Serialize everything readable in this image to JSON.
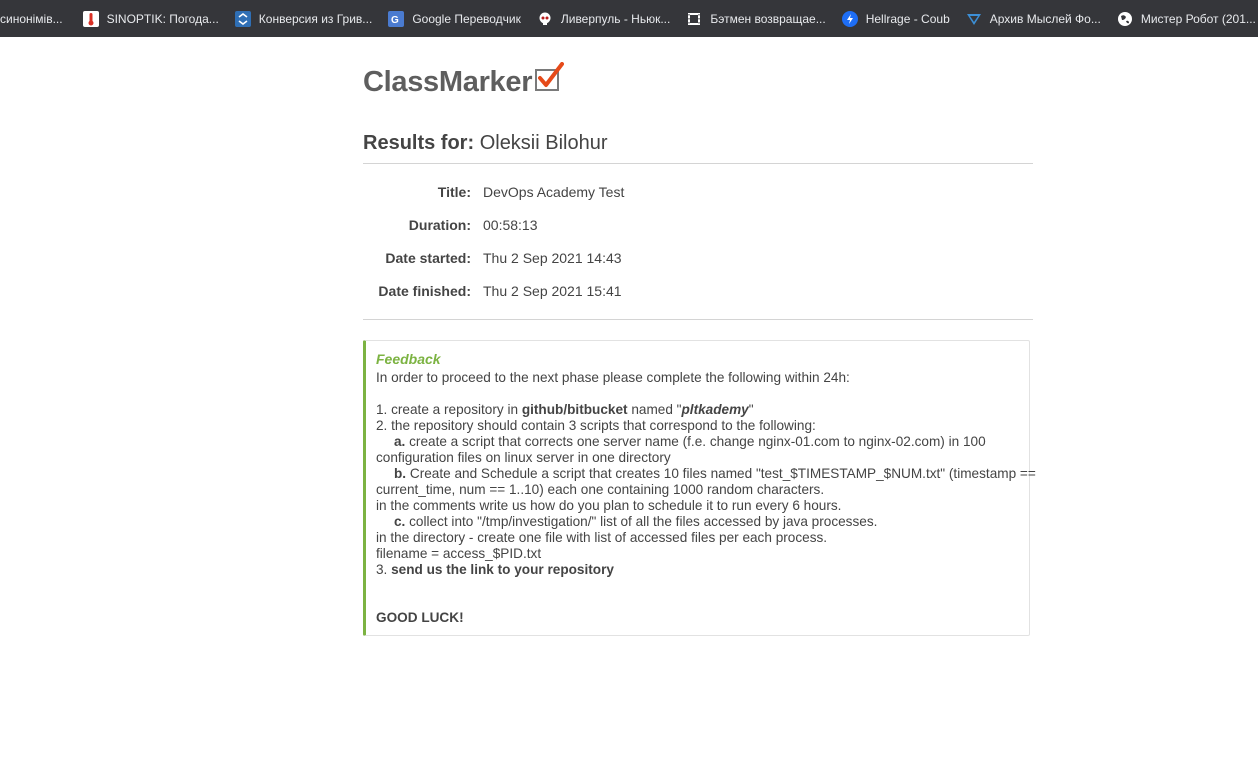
{
  "bookmarks": [
    {
      "label": "синонімів...",
      "icon": "none"
    },
    {
      "label": "SINOPTIK: Погода...",
      "icon": "thermometer-icon",
      "color": "#ffffff"
    },
    {
      "label": "Конверсия из Грив...",
      "icon": "currency-icon",
      "color": "#2f6fb5"
    },
    {
      "label": "Google Переводчик",
      "icon": "google-translate-icon",
      "color": "#4a7bd0"
    },
    {
      "label": "Ливерпуль - Ньюк...",
      "icon": "skull-icon",
      "color": "#ffffff"
    },
    {
      "label": "Бэтмен возвращае...",
      "icon": "film-icon",
      "color": "#ffffff"
    },
    {
      "label": "Hellrage - Coub",
      "icon": "coub-icon",
      "color": "#1e6ef5"
    },
    {
      "label": "Архив Мыслей Фо...",
      "icon": "mind-icon",
      "color": "#3c8fd6"
    },
    {
      "label": "Мистер Робот (201...",
      "icon": "globe-icon",
      "color": "#ffffff"
    }
  ],
  "logo": {
    "text": "ClassMarker"
  },
  "results": {
    "label": "Results for:",
    "name": "Oleksii Bilohur"
  },
  "info": [
    {
      "key": "Title:",
      "value": "DevOps Academy Test"
    },
    {
      "key": "Duration:",
      "value": "00:58:13"
    },
    {
      "key": "Date started:",
      "value": "Thu 2 Sep 2021 14:43"
    },
    {
      "key": "Date finished:",
      "value": "Thu 2 Sep 2021 15:41"
    }
  ],
  "feedback": {
    "heading": "Feedback",
    "intro": "In order to proceed to the next phase please complete the following within 24h:",
    "item1_pre": "1. create a repository in ",
    "item1_bold": "github/bitbucket",
    "item1_mid": " named \"",
    "item1_name": "pltkademy",
    "item1_post": "\"",
    "item2": "2. the repository should contain 3 scripts that correspond to the following:",
    "a_label": "a.",
    "a_text1": " create a script that corrects one server name (f.e. change nginx-01.com to nginx-02.com) in 100",
    "a_text2": "configuration files on linux server in one directory",
    "b_label": "b.",
    "b_text1": " Create and Schedule a script that creates 10 files named \"test_$TIMESTAMP_$NUM.txt\" (timestamp ==",
    "b_text2": "current_time, num == 1..10) each one containing 1000 random characters.",
    "b_text3": "in the comments write us how do you plan to schedule it to run every 6 hours.",
    "c_label": "c.",
    "c_text1": " collect into \"/tmp/investigation/\" list of all the files accessed by java processes.",
    "c_text2": "in the directory - create one file with list of accessed files per each process.",
    "c_text3": "filename = access_$PID.txt",
    "item3_pre": "3. ",
    "item3_bold": "send us the link to your repository",
    "closing": "GOOD LUCK!"
  },
  "colors": {
    "accent_green": "#7cb342",
    "logo_check": "#e64a19",
    "text": "#444444",
    "bookmarks_bar": "#35363a"
  }
}
